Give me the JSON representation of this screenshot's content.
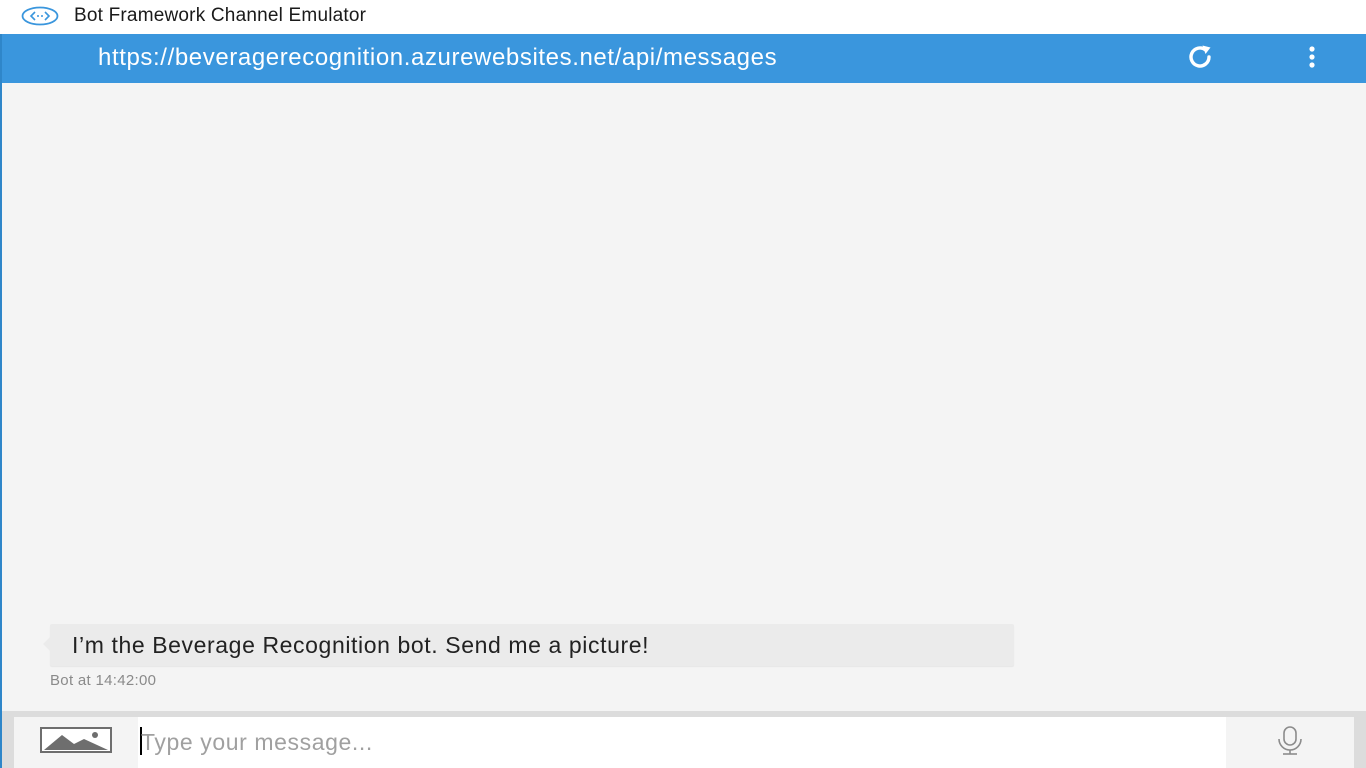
{
  "window": {
    "title": "Bot Framework Channel Emulator"
  },
  "address_bar": {
    "endpoint_url": "https://beveragerecognition.azurewebsites.net/api/messages"
  },
  "conversation": {
    "messages": [
      {
        "from": "bot",
        "text": "I’m the Beverage Recognition bot. Send me a picture!",
        "timestamp": "Bot at 14:42:00"
      }
    ]
  },
  "composer": {
    "placeholder": "Type your message...",
    "value": ""
  },
  "icons": {
    "app": "emulator-icon",
    "refresh": "refresh-icon",
    "menu": "more-vertical-icon",
    "upload": "image-icon",
    "mic": "microphone-icon"
  },
  "colors": {
    "accent": "#3a96dd",
    "chat_background": "#f4f4f4",
    "bot_bubble": "#ebebeb"
  }
}
